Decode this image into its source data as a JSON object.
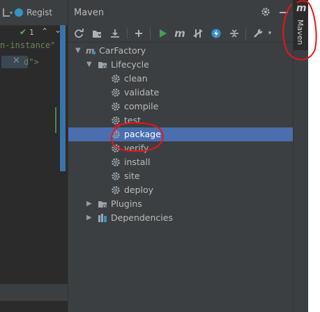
{
  "editor": {
    "run_config": "Regist",
    "problems_count": "1",
    "code_lines": [
      "n-instance\"",
      "d\">"
    ]
  },
  "maven": {
    "title": "Maven",
    "toolbar_icons": [
      "reload-icon",
      "generate-sources-icon",
      "download-icon",
      "add-icon",
      "run-icon",
      "execute-goal-icon",
      "skip-tests-icon",
      "offline-icon",
      "collapse-all-icon",
      "settings-icon"
    ],
    "tree": {
      "project": "CarFactory",
      "lifecycle_label": "Lifecycle",
      "lifecycle_items": [
        "clean",
        "validate",
        "compile",
        "test",
        "package",
        "verify",
        "install",
        "site",
        "deploy"
      ],
      "selected": "package",
      "plugins_label": "Plugins",
      "dependencies_label": "Dependencies"
    }
  },
  "right_stripe": {
    "maven_tab_label": "Maven",
    "maven_tab_glyph": "m"
  },
  "colors": {
    "selection": "#4b6eaf",
    "run_green": "#499c54",
    "annotation_red": "#e8141c"
  }
}
